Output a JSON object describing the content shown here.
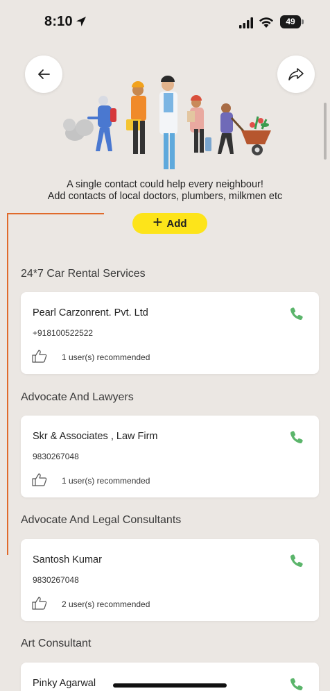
{
  "status": {
    "time": "8:10",
    "battery": "49",
    "location_icon": "location-arrow-icon",
    "signal_icon": "signal-icon",
    "wifi_icon": "wifi-icon"
  },
  "header": {
    "back_icon": "arrow-left-icon",
    "share_icon": "share-arrow-icon",
    "illustration": "service-workers-illustration"
  },
  "intro": {
    "line1": "A single contact could help every neighbour!",
    "line2": "Add contacts of local doctors, plumbers, milkmen etc"
  },
  "add_button": {
    "label": "Add",
    "icon": "plus-icon",
    "color": "#fde41a"
  },
  "colors": {
    "background": "#ebe7e3",
    "call_green": "#5bb56b",
    "annotation": "#e06a2b"
  },
  "categories": [
    {
      "title": "24*7 Car Rental Services",
      "contacts": [
        {
          "name": "Pearl Carzonrent. Pvt. Ltd",
          "phone": "+918100522522",
          "recommended": "1 user(s) recommended"
        }
      ]
    },
    {
      "title": "Advocate And Lawyers",
      "contacts": [
        {
          "name": "Skr & Associates , Law Firm",
          "phone": "9830267048",
          "recommended": "1 user(s) recommended"
        }
      ]
    },
    {
      "title": "Advocate And Legal Consultants",
      "contacts": [
        {
          "name": "Santosh Kumar",
          "phone": "9830267048",
          "recommended": "2 user(s) recommended"
        }
      ]
    },
    {
      "title": "Art Consultant",
      "contacts": [
        {
          "name": "Pinky Agarwal"
        }
      ]
    }
  ]
}
